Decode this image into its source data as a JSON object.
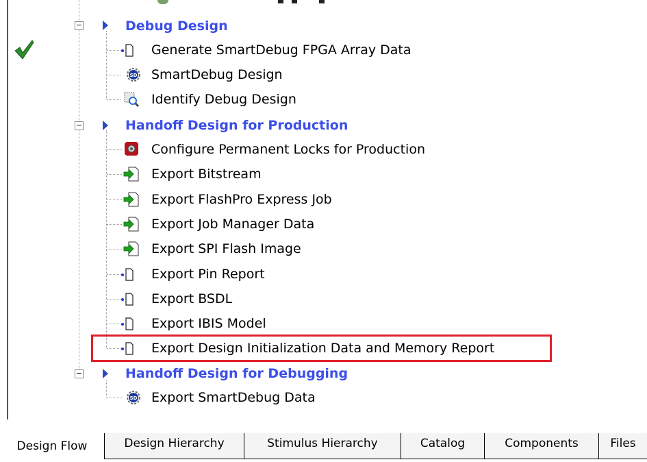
{
  "tree": {
    "groups": [
      {
        "title": "Debug Design",
        "items": [
          {
            "label": "Generate SmartDebug FPGA Array Data",
            "icon": "document-icon",
            "status": "completed-check"
          },
          {
            "label": "SmartDebug Design",
            "icon": "smartdebug-icon"
          },
          {
            "label": "Identify Debug Design",
            "icon": "identify-debug-icon"
          }
        ]
      },
      {
        "title": "Handoff Design for Production",
        "items": [
          {
            "label": "Configure Permanent Locks for Production",
            "icon": "lock-config-icon"
          },
          {
            "label": "Export Bitstream",
            "icon": "export-arrow-icon"
          },
          {
            "label": "Export FlashPro Express Job",
            "icon": "export-arrow-icon"
          },
          {
            "label": "Export Job Manager Data",
            "icon": "export-arrow-icon"
          },
          {
            "label": "Export SPI Flash Image",
            "icon": "export-arrow-icon"
          },
          {
            "label": "Export Pin Report",
            "icon": "document-icon"
          },
          {
            "label": "Export BSDL",
            "icon": "document-icon"
          },
          {
            "label": "Export IBIS Model",
            "icon": "document-icon"
          },
          {
            "label": "Export Design Initialization Data and Memory Report",
            "icon": "document-icon",
            "highlighted": true
          }
        ]
      },
      {
        "title": "Handoff Design for Debugging",
        "items": [
          {
            "label": "Export SmartDebug Data",
            "icon": "smartdebug-icon"
          }
        ]
      }
    ]
  },
  "tabs": [
    {
      "label": "Design Flow",
      "active": true
    },
    {
      "label": "Design Hierarchy"
    },
    {
      "label": "Stimulus Hierarchy"
    },
    {
      "label": "Catalog"
    },
    {
      "label": "Components"
    },
    {
      "label": "Files"
    }
  ],
  "colors": {
    "group_title": "#3b4fe8",
    "highlight_border": "#e0202b",
    "check": "#2e8b2e",
    "export_arrow": "#1ea11e"
  }
}
